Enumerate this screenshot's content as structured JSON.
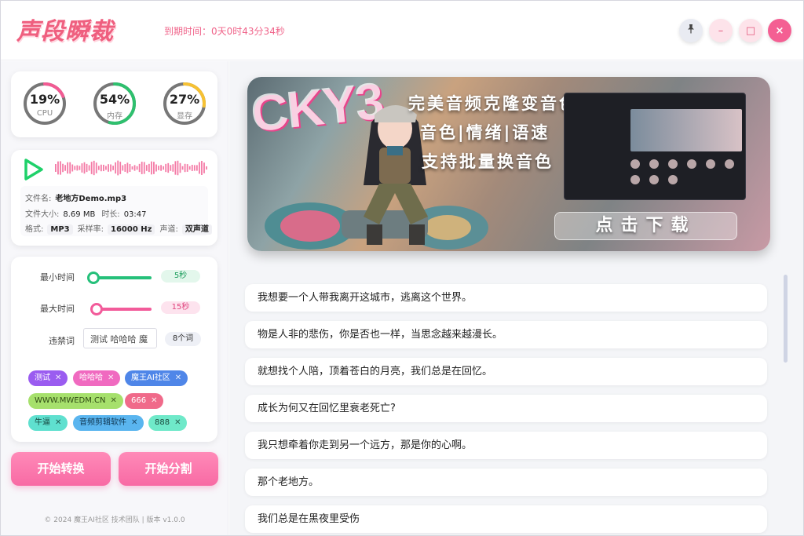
{
  "app": {
    "logo": "声段瞬裁",
    "expire_label": "到期时间：",
    "expire_value": "0天0时43分34秒"
  },
  "window_controls": {
    "pin_icon": "pin-icon",
    "minimize": "–",
    "maximize": "□",
    "close": "×"
  },
  "gauges": [
    {
      "value": "19%",
      "label": "CPU",
      "percent": 19,
      "color": "#f25b93"
    },
    {
      "value": "54%",
      "label": "内存",
      "percent": 54,
      "color": "#2ec06e"
    },
    {
      "value": "27%",
      "label": "显存",
      "percent": 27,
      "color": "#f6c133"
    }
  ],
  "audio": {
    "filename_label": "文件名:",
    "filename": "老地方Demo.mp3",
    "size_label": "文件大小:",
    "size": "8.69 MB",
    "duration_label": "时长:",
    "duration": "03:47",
    "format_label": "格式:",
    "format": "MP3",
    "samplerate_label": "采样率:",
    "samplerate": "16000 Hz",
    "channel_label": "声道:",
    "channel": "双声道",
    "accent": "#1fd16a",
    "wave_color": "#f47aa6"
  },
  "settings": {
    "min_label": "最小时间",
    "min_value": "5秒",
    "min_fraction": 0.05,
    "max_label": "最大时间",
    "max_value": "15秒",
    "max_fraction": 0.1,
    "ban_label": "违禁词",
    "ban_input": "测试 哈哈哈 魔",
    "ban_count": "8个词",
    "tags": [
      {
        "text": "测试",
        "bg": "#9a5cf0",
        "fg": "#ffffff"
      },
      {
        "text": "哈哈哈",
        "bg": "#f06ac0",
        "fg": "#ffffff"
      },
      {
        "text": "魔王AI社区",
        "bg": "#4f86e8",
        "fg": "#ffffff"
      },
      {
        "text": "WWW.MWEDM.CN",
        "bg": "#a6e06c",
        "fg": "#2f4a14"
      },
      {
        "text": "666",
        "bg": "#f06a8a",
        "fg": "#ffffff"
      },
      {
        "text": "牛逼",
        "bg": "#5fe0cf",
        "fg": "#14443d"
      },
      {
        "text": "音频剪辑软件",
        "bg": "#5ab5ef",
        "fg": "#0f3550"
      },
      {
        "text": "888",
        "bg": "#6fe9c9",
        "fg": "#1b4a3d"
      }
    ]
  },
  "actions": {
    "convert": "开始转换",
    "split": "开始分割"
  },
  "footer": "© 2024 魔王AI社区 技术团队  |  版本 v1.0.0",
  "banner": {
    "graffiti": "CKY3",
    "line1": "完美音频克隆变音色",
    "line2": "音色|情绪|语速",
    "line3": "支持批量换音色",
    "download": "点击下载"
  },
  "sentences": [
    "我想要一个人带我离开这城市，逃离这个世界。",
    "物是人非的悲伤，你是否也一样，当思念越来越漫长。",
    "就想找个人陪，顶着苍白的月亮，我们总是在回忆。",
    "成长为何又在回忆里衰老死亡?",
    "我只想牵着你走到另一个远方，那是你的心啊。",
    "那个老地方。",
    "我们总是在黑夜里受伤"
  ]
}
